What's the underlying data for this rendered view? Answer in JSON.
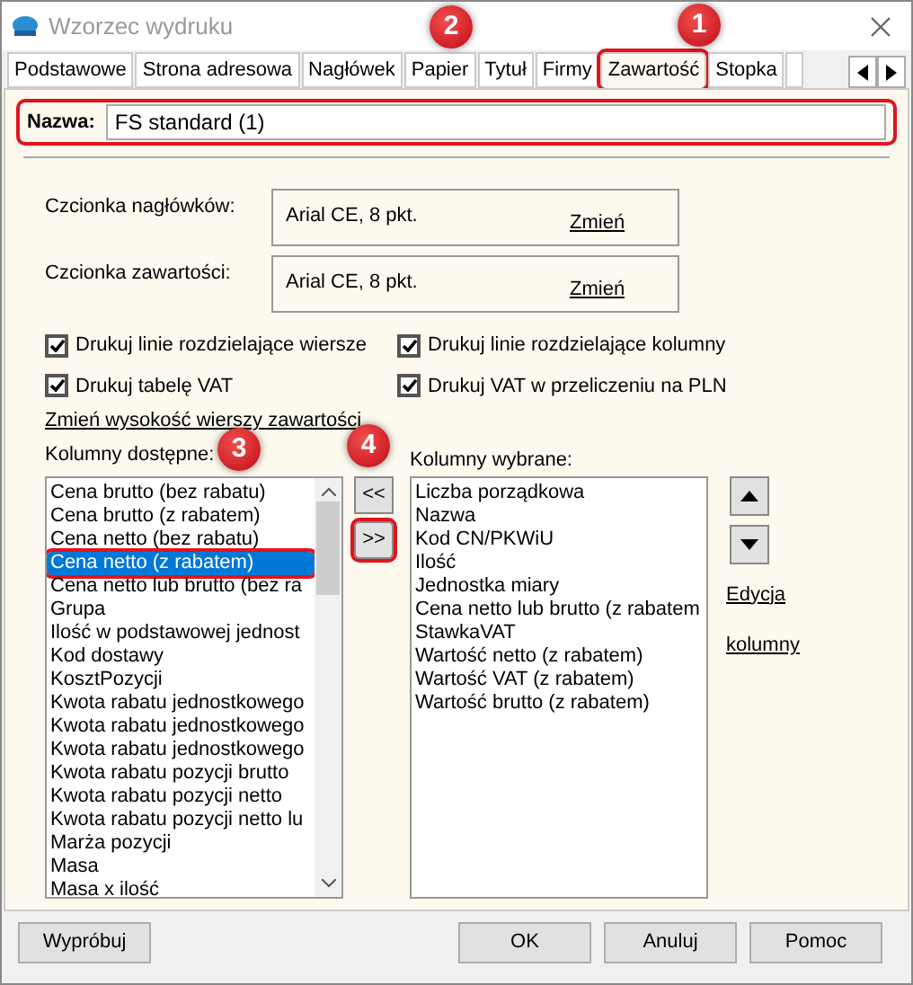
{
  "window": {
    "title": "Wzorzec wydruku"
  },
  "tabs": [
    {
      "label": "Podstawowe",
      "selected": false,
      "highlighted": false
    },
    {
      "label": "Strona adresowa",
      "selected": false,
      "highlighted": false
    },
    {
      "label": "Nagłówek",
      "selected": false,
      "highlighted": false
    },
    {
      "label": "Papier",
      "selected": false,
      "highlighted": false
    },
    {
      "label": "Tytuł",
      "selected": false,
      "highlighted": false
    },
    {
      "label": "Firmy",
      "selected": false,
      "highlighted": false
    },
    {
      "label": "Zawartość",
      "selected": true,
      "highlighted": true
    },
    {
      "label": "Stopka",
      "selected": false,
      "highlighted": false
    }
  ],
  "name_field": {
    "label": "Nazwa:",
    "value": "FS standard (1)",
    "highlighted": true
  },
  "fonts": [
    {
      "label": "Czcionka nagłówków:",
      "value": "Arial CE, 8 pkt.",
      "link": "Zmień"
    },
    {
      "label": "Czcionka zawartości:",
      "value": "Arial CE, 8 pkt.",
      "link": "Zmień"
    }
  ],
  "checkboxes": [
    {
      "label": "Drukuj linie rozdzielające wiersze",
      "checked": true
    },
    {
      "label": "Drukuj linie rozdzielające kolumny",
      "checked": true
    },
    {
      "label": "Drukuj tabelę VAT",
      "checked": true
    },
    {
      "label": "Drukuj VAT w przeliczeniu na PLN",
      "checked": true
    }
  ],
  "row_height_link": "Zmień wysokość wierszy zawartości",
  "available": {
    "label": "Kolumny dostępne:",
    "items": [
      {
        "text": "Cena brutto (bez rabatu)",
        "selected": false,
        "highlighted": false
      },
      {
        "text": "Cena brutto (z rabatem)",
        "selected": false,
        "highlighted": false
      },
      {
        "text": "Cena netto (bez rabatu)",
        "selected": false,
        "highlighted": false
      },
      {
        "text": "Cena netto (z rabatem)",
        "selected": true,
        "highlighted": true
      },
      {
        "text": "Cena netto lub brutto (bez ra",
        "selected": false,
        "highlighted": false
      },
      {
        "text": "Grupa",
        "selected": false,
        "highlighted": false
      },
      {
        "text": "Ilość w podstawowej jednost",
        "selected": false,
        "highlighted": false
      },
      {
        "text": "Kod dostawy",
        "selected": false,
        "highlighted": false
      },
      {
        "text": "KosztPozycji",
        "selected": false,
        "highlighted": false
      },
      {
        "text": "Kwota rabatu jednostkowego",
        "selected": false,
        "highlighted": false
      },
      {
        "text": "Kwota rabatu jednostkowego",
        "selected": false,
        "highlighted": false
      },
      {
        "text": "Kwota rabatu jednostkowego",
        "selected": false,
        "highlighted": false
      },
      {
        "text": "Kwota rabatu pozycji brutto",
        "selected": false,
        "highlighted": false
      },
      {
        "text": "Kwota rabatu pozycji netto",
        "selected": false,
        "highlighted": false
      },
      {
        "text": "Kwota rabatu pozycji netto lu",
        "selected": false,
        "highlighted": false
      },
      {
        "text": "Marża pozycji",
        "selected": false,
        "highlighted": false
      },
      {
        "text": "Masa",
        "selected": false,
        "highlighted": false
      },
      {
        "text": "Masa x ilość",
        "selected": false,
        "highlighted": false
      }
    ]
  },
  "move_buttons": [
    {
      "label": "<<",
      "highlighted": false
    },
    {
      "label": ">>",
      "highlighted": true
    }
  ],
  "chosen": {
    "label": "Kolumny wybrane:",
    "items": [
      "Liczba porządkowa",
      "Nazwa",
      "Kod CN/PKWiU",
      "Ilość",
      "Jednostka miary",
      "Cena netto lub brutto (z rabatem",
      "StawkaVAT",
      "Wartość netto (z rabatem)",
      "Wartość VAT (z rabatem)",
      "Wartość brutto (z rabatem)"
    ]
  },
  "edit_link": [
    "Edycja",
    "kolumny"
  ],
  "buttons": {
    "left": "Wypróbuj",
    "right": [
      "OK",
      "Anuluj",
      "Pomoc"
    ]
  },
  "callouts": [
    "1",
    "2",
    "3",
    "4"
  ]
}
